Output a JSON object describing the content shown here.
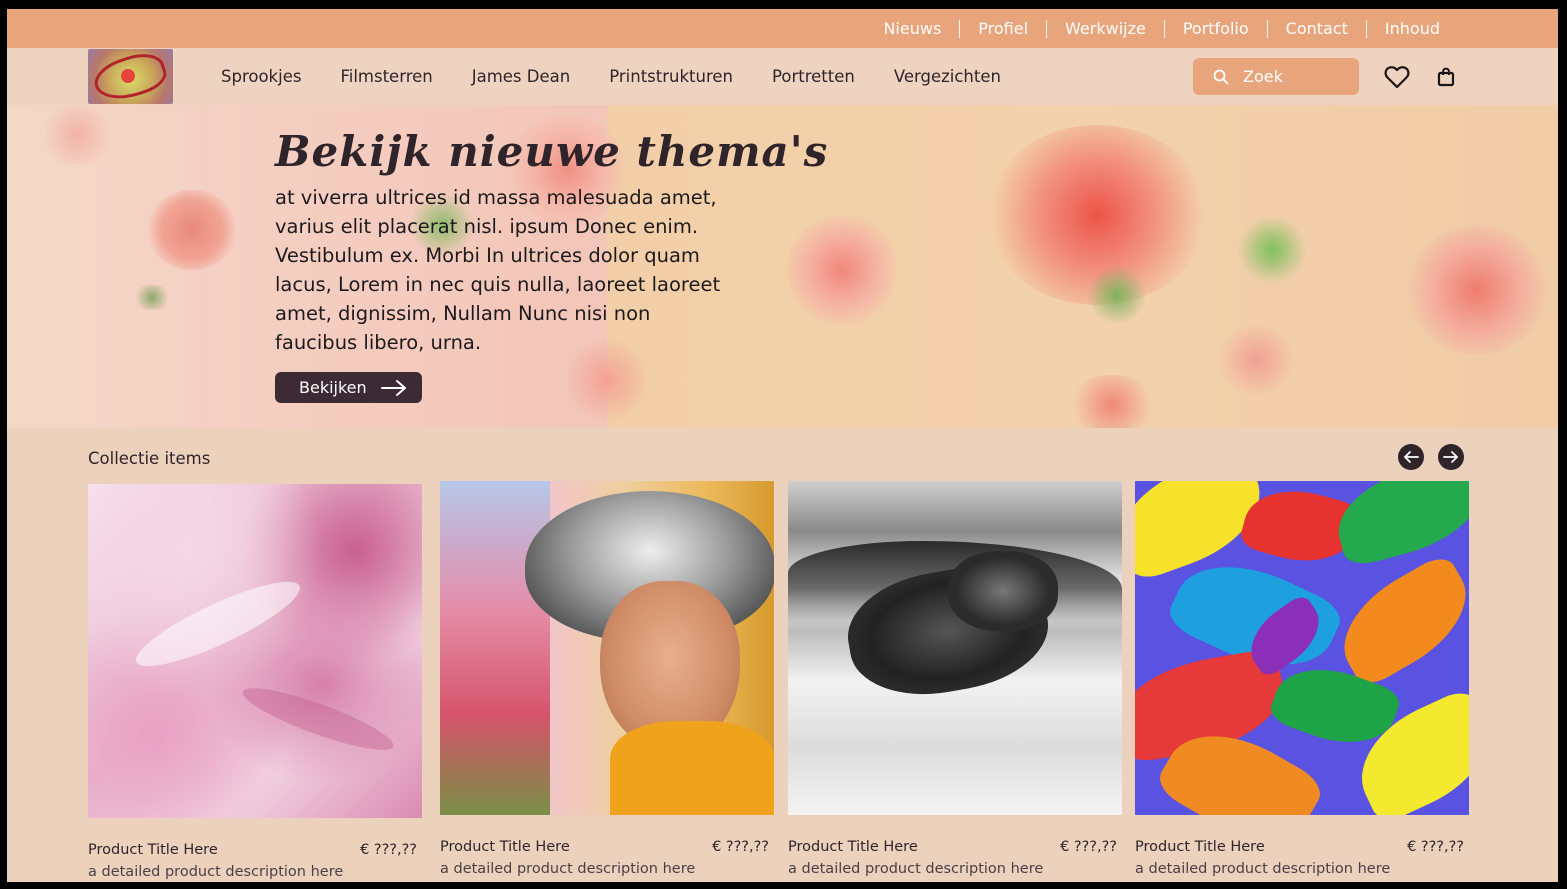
{
  "topnav": {
    "items": [
      "Nieuws",
      "Profiel",
      "Werkwijze",
      "Portfolio",
      "Contact",
      "Inhoud"
    ]
  },
  "logo": {
    "alt": "Web Leenooz logo"
  },
  "catnav": {
    "items": [
      "Sprookjes",
      "Filmsterren",
      "James Dean",
      "Printstrukturen",
      "Portretten",
      "Vergezichten"
    ]
  },
  "search": {
    "placeholder": "Zoek",
    "icon": "search-icon"
  },
  "icons": {
    "favorites": "heart-icon",
    "cart": "shopping-bag-icon"
  },
  "hero": {
    "title": "Bekijk nieuwe thema's",
    "text": "at viverra ultrices id massa malesuada amet, varius elit placerat nisl. ipsum Donec enim. Vestibulum ex. Morbi In ultrices dolor quam lacus, Lorem in nec quis nulla, laoreet laoreet amet, dignissim, Nullam Nunc nisi non faucibus libero, urna.",
    "button_label": "Bekijken"
  },
  "collection": {
    "title": "Collectie items",
    "cards": [
      {
        "title": "Product Title Here",
        "price": "€ ???,??",
        "description": "a detailed product description here"
      },
      {
        "title": "Product Title Here",
        "price": "€ ???,??",
        "description": "a detailed product description here"
      },
      {
        "title": "Product Title Here",
        "price": "€ ???,??",
        "description": "a detailed product description here"
      },
      {
        "title": "Product Title Here",
        "price": "€ ???,??",
        "description": "a detailed product description here"
      }
    ]
  },
  "colors": {
    "topbar": "#e8a57c",
    "mainbar": "#eed3c0",
    "page": "#ecd2bd",
    "dark": "#3d2b33",
    "search": "#e8a57c"
  }
}
